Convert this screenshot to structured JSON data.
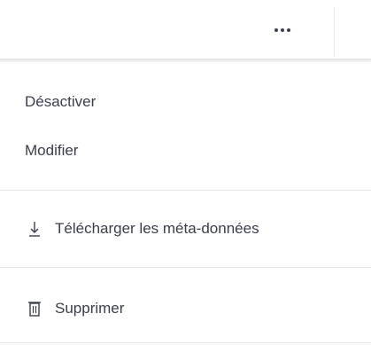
{
  "header": {
    "more_icon": "more-horizontal-icon"
  },
  "menu": {
    "items": [
      {
        "label": "Désactiver"
      },
      {
        "label": "Modifier"
      },
      {
        "label": "Télécharger les méta-données",
        "icon": "download-icon"
      },
      {
        "label": "Supprimer",
        "icon": "trash-icon"
      }
    ]
  },
  "colors": {
    "text": "#3a3f4b",
    "divider": "#e4e6ea",
    "background": "#ffffff"
  }
}
